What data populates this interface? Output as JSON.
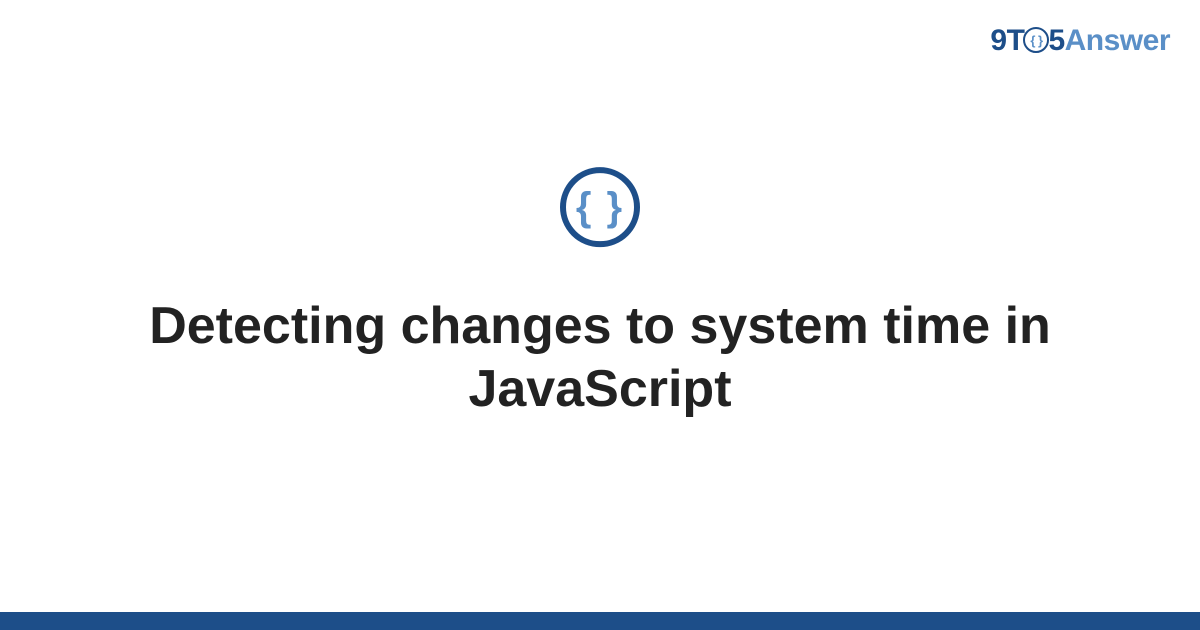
{
  "brand": {
    "part1": "9T",
    "circle_inner": "{ }",
    "part2": "5",
    "part3": "Answer"
  },
  "icon": {
    "braces": "{ }"
  },
  "title": "Detecting changes to system time in JavaScript",
  "colors": {
    "primary": "#1d4e89",
    "accent": "#5a8fc7",
    "text": "#222222"
  }
}
